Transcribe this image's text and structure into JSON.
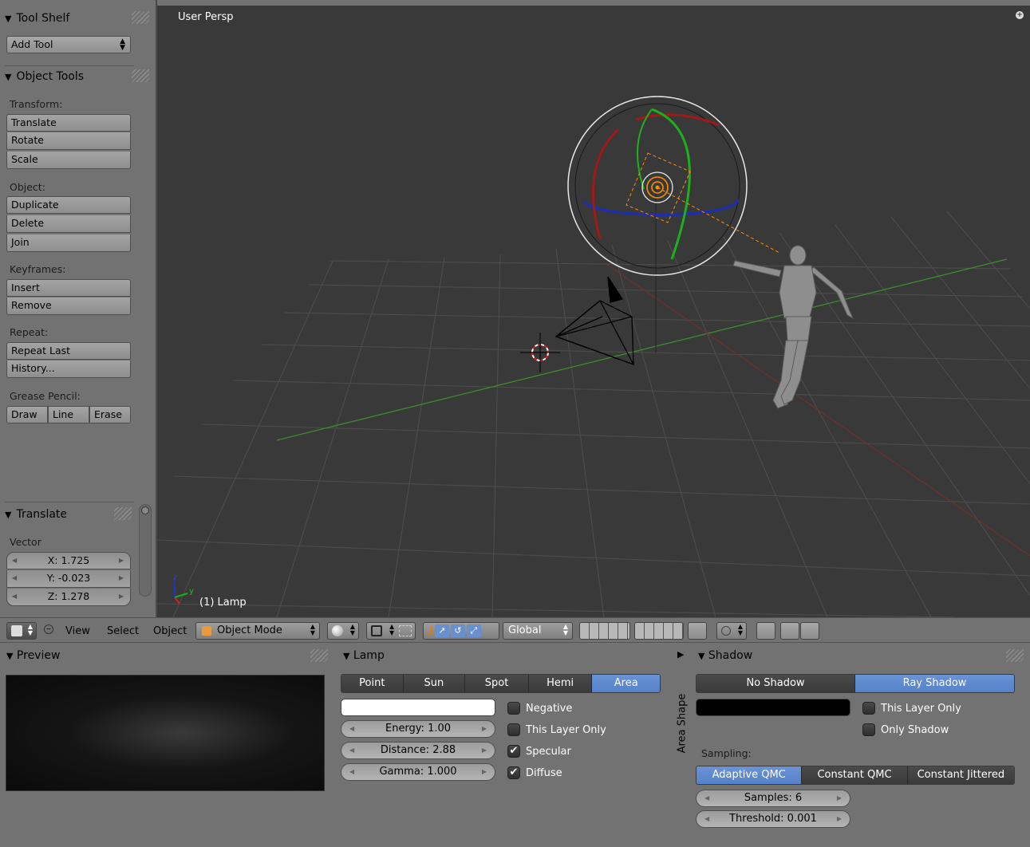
{
  "toolshelf": {
    "title": "Tool Shelf",
    "add_tool": "Add Tool",
    "object_tools_title": "Object Tools",
    "transform_label": "Transform:",
    "translate": "Translate",
    "rotate": "Rotate",
    "scale": "Scale",
    "object_label": "Object:",
    "duplicate": "Duplicate",
    "delete": "Delete",
    "join": "Join",
    "keyframes_label": "Keyframes:",
    "insert": "Insert",
    "remove": "Remove",
    "repeat_label": "Repeat:",
    "repeat_last": "Repeat Last",
    "history": "History...",
    "grease_pencil_label": "Grease Pencil:",
    "draw": "Draw",
    "line": "Line",
    "erase": "Erase",
    "translate_panel_title": "Translate",
    "vector_label": "Vector",
    "x": "X: 1.725",
    "y": "Y: -0.023",
    "z": "Z: 1.278"
  },
  "viewport": {
    "title": "User Persp",
    "object_name": "(1) Lamp",
    "axis_z": "z",
    "axis_y": "y"
  },
  "header": {
    "view": "View",
    "select": "Select",
    "object": "Object",
    "mode": "Object Mode",
    "orientation": "Global"
  },
  "preview": {
    "title": "Preview"
  },
  "lamp": {
    "title": "Lamp",
    "types": [
      "Point",
      "Sun",
      "Spot",
      "Hemi",
      "Area"
    ],
    "active_type": "Area",
    "color": "#ffffff",
    "negative": "Negative",
    "negative_checked": false,
    "this_layer_only": "This Layer Only",
    "this_layer_only_checked": false,
    "specular": "Specular",
    "specular_checked": true,
    "diffuse": "Diffuse",
    "diffuse_checked": true,
    "energy": "Energy: 1.00",
    "distance": "Distance: 2.88",
    "gamma": "Gamma: 1.000"
  },
  "area_shape": {
    "label": "Area Shape"
  },
  "shadow": {
    "title": "Shadow",
    "modes": [
      "No Shadow",
      "Ray Shadow"
    ],
    "active_mode": "Ray Shadow",
    "color": "#000000",
    "this_layer_only": "This Layer Only",
    "only_shadow": "Only Shadow",
    "sampling_label": "Sampling:",
    "sampling_modes": [
      "Adaptive QMC",
      "Constant QMC",
      "Constant Jittered"
    ],
    "active_sampling": "Adaptive QMC",
    "samples": "Samples: 6",
    "threshold": "Threshold: 0.001"
  },
  "colors": {
    "ui_bg": "#727272",
    "viewport_bg": "#393939",
    "active_blue": "#5680c8",
    "x_axis": "#cc2222",
    "y_axis": "#22aa22",
    "z_axis": "#2233cc",
    "lamp_orange": "#ff8c00"
  }
}
